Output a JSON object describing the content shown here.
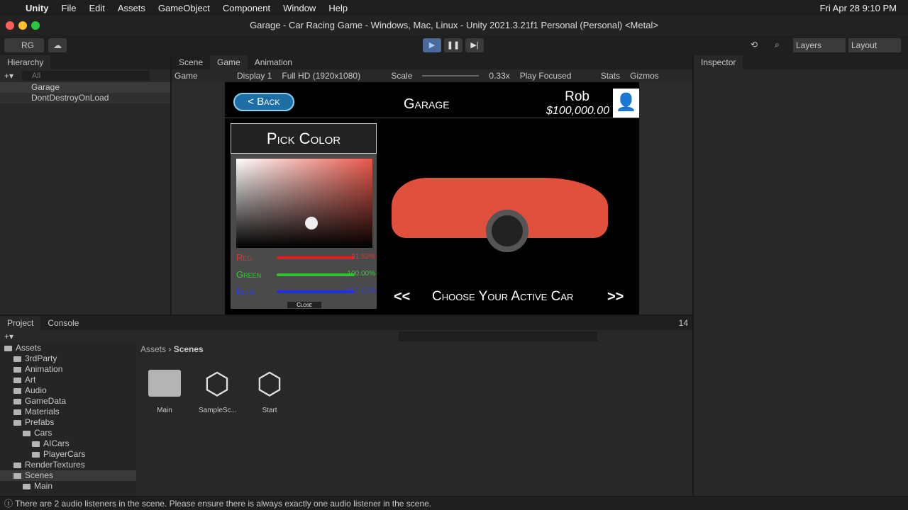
{
  "menubar": {
    "items": [
      "Unity",
      "File",
      "Edit",
      "Assets",
      "GameObject",
      "Component",
      "Window",
      "Help"
    ],
    "clock": "Fri Apr 28  9:10 PM"
  },
  "window_title": "Garage - Car Racing Game - Windows, Mac, Linux - Unity 2021.3.21f1 Personal (Personal) <Metal>",
  "toolbar": {
    "account": "RG",
    "layers": "Layers",
    "layout": "Layout"
  },
  "hierarchy": {
    "tab": "Hierarchy",
    "search_placeholder": "All",
    "items": [
      "Garage",
      "DontDestroyOnLoad"
    ]
  },
  "game_view": {
    "tabs": [
      "Scene",
      "Game",
      "Animation"
    ],
    "mode": "Game",
    "display": "Display 1",
    "resolution": "Full HD (1920x1080)",
    "scale_label": "Scale",
    "scale_value": "0.33x",
    "play_mode": "Play Focused",
    "stats": "Stats",
    "gizmos": "Gizmos"
  },
  "game": {
    "back": "< Back",
    "title": "Garage",
    "player_name": "Rob",
    "money": "$100,000.00",
    "pick_color": "Pick Color",
    "red_label": "Red",
    "red_value": "91.52%",
    "green_label": "Green",
    "green_value": "100.00%",
    "blue_label": "Blue",
    "blue_value": "100.00%",
    "close": "Close",
    "prev": "<<",
    "next": ">>",
    "choose_car": "Choose Your Active Car",
    "red_fraction": 0.9152,
    "green_fraction": 1.0,
    "blue_fraction": 1.0,
    "picked_color": "#e8574a"
  },
  "inspector": {
    "tab": "Inspector"
  },
  "project": {
    "tabs": [
      "Project",
      "Console"
    ],
    "hidden_count": "14",
    "breadcrumb": [
      "Assets",
      "Scenes"
    ],
    "tree": [
      {
        "label": "Assets",
        "depth": 0
      },
      {
        "label": "3rdParty",
        "depth": 1
      },
      {
        "label": "Animation",
        "depth": 1
      },
      {
        "label": "Art",
        "depth": 1
      },
      {
        "label": "Audio",
        "depth": 1
      },
      {
        "label": "GameData",
        "depth": 1
      },
      {
        "label": "Materials",
        "depth": 1
      },
      {
        "label": "Prefabs",
        "depth": 1
      },
      {
        "label": "Cars",
        "depth": 2
      },
      {
        "label": "AICars",
        "depth": 3
      },
      {
        "label": "PlayerCars",
        "depth": 3
      },
      {
        "label": "RenderTextures",
        "depth": 1
      },
      {
        "label": "Scenes",
        "depth": 1
      },
      {
        "label": "Main",
        "depth": 2
      }
    ],
    "files": [
      {
        "name": "Main",
        "type": "folder"
      },
      {
        "name": "SampleSc...",
        "type": "scene"
      },
      {
        "name": "Start",
        "type": "scene"
      }
    ]
  },
  "status": {
    "message": "There are 2 audio listeners in the scene. Please ensure there is always exactly one audio listener in the scene."
  }
}
